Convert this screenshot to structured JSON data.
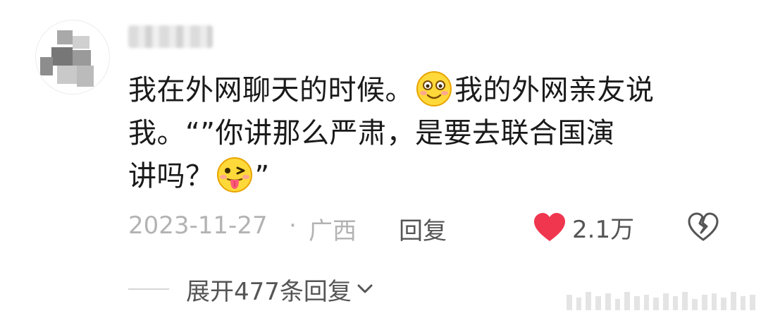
{
  "comment": {
    "line1_text": "我在外网聊天的时候。",
    "line1_emoji": "smile-emoji",
    "line1_rest": "我的外网亲友说",
    "line2": "我。“”你讲那么严肃，是要去联合国演",
    "line3_text": "讲吗？",
    "line3_emoji": "tongue-wink-emoji",
    "line3_end": "”"
  },
  "meta": {
    "date": "2023-11-27",
    "separator": "·",
    "location": "广西",
    "reply_label": "回复",
    "like_count": "2.1万"
  },
  "expand": {
    "label": "展开477条回复"
  },
  "colors": {
    "heart": "#f0364f",
    "meta_gray": "#b3b3b3",
    "text": "#1a1a1a"
  }
}
